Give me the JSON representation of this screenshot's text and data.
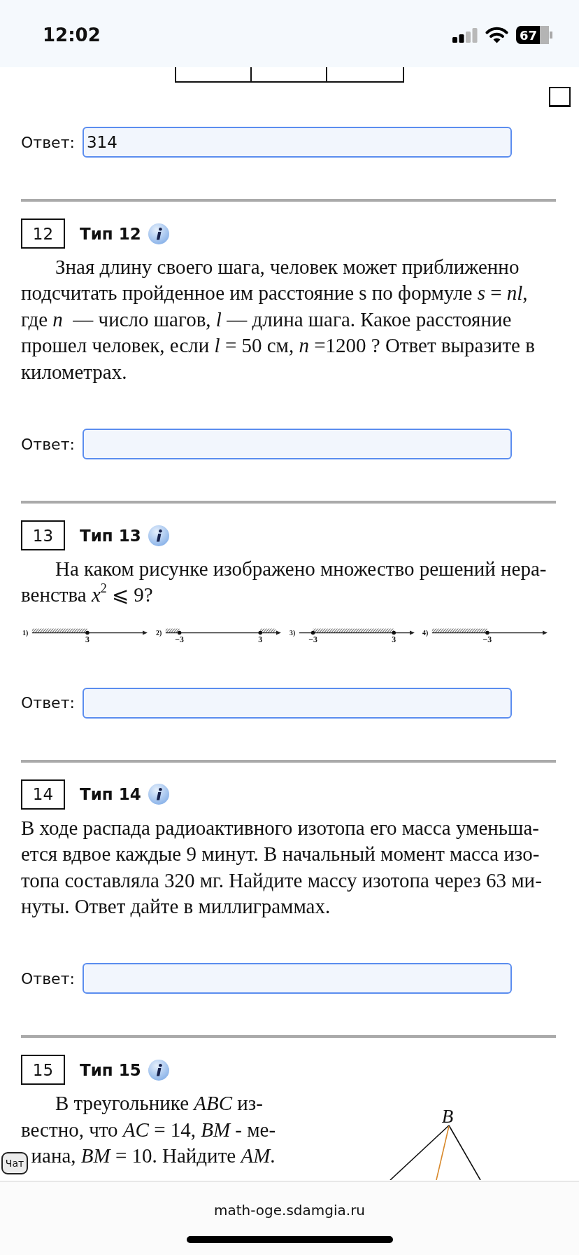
{
  "status_bar": {
    "time": "12:02",
    "battery": "67"
  },
  "previous_problem": {
    "answer": {
      "label": "Ответ:",
      "value": "314"
    }
  },
  "problems": [
    {
      "number": "12",
      "type": "Тип 12",
      "indent": true,
      "text": "Зная длину своего шага, человек может приближенно\nподсчитать пройденное им расстояние s по формуле *s* = *nl*,\nгде *n*  — число шагов, *l* — длина шага. Какое расстояние\nпрошел человек, если *l* = 50 см, *n* =1200 ? Ответ выразите в\nкилометрах.",
      "answer": {
        "label": "Ответ:"
      }
    },
    {
      "number": "13",
      "type": "Тип 13",
      "indent": true,
      "text": "На каком рисунке изображено множество решений нера-\nвенства *x*$^{2}$ ⩽ 9?",
      "figure": {
        "kind": "number-lines",
        "options": [
          {
            "label": "1)",
            "kind": "left-ray",
            "points": [
              "3"
            ]
          },
          {
            "label": "2)",
            "kind": "outside",
            "points": [
              "−3",
              "3"
            ]
          },
          {
            "label": "3)",
            "kind": "between",
            "points": [
              "−3",
              "3"
            ]
          },
          {
            "label": "4)",
            "kind": "left-ray",
            "points": [
              "−3"
            ]
          }
        ]
      },
      "answer": {
        "label": "Ответ:"
      }
    },
    {
      "number": "14",
      "type": "Тип 14",
      "indent": false,
      "text": "В ходе распада радиоактивного изотопа его масса уменьша-\nется вдвое каждые 9 минут. В начальный момент масса изо-\nтопа составляла 320 мг. Найдите массу изотопа через 63 ми-\nнуты. Ответ дайте в миллиграммах.",
      "answer": {
        "label": "Ответ:"
      }
    },
    {
      "number": "15",
      "type": "Тип 15",
      "indent": true,
      "text": "В треугольнике *ABC* из-\nвестно, что *AC* = 14, *BM* - ме-\n  иана, *BM* = 10. Найдите *AM*.",
      "figure": {
        "kind": "triangle",
        "vertex_labels": [
          "B"
        ]
      }
    }
  ],
  "chat_button": {
    "label": "Чат"
  },
  "browser_bar": {
    "url": "math-oge.sdamgia.ru"
  }
}
